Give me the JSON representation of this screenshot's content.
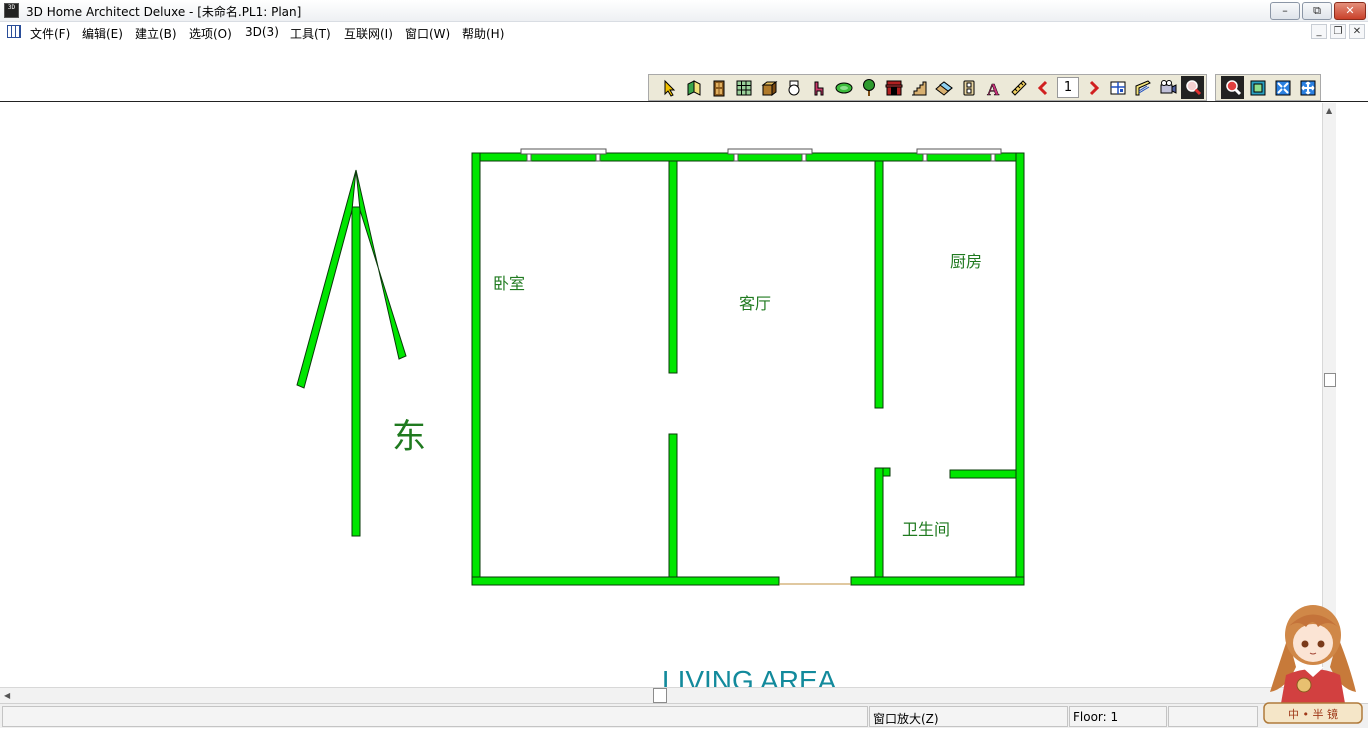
{
  "window": {
    "title": "3D Home Architect Deluxe - [未命名.PL1: Plan]",
    "app_icon_text": "3D",
    "minimize_glyph": "–",
    "restore_glyph": "⧉",
    "close_glyph": "✕"
  },
  "menu": {
    "items": [
      "文件(F)",
      "编辑(E)",
      "建立(B)",
      "选项(O)",
      "3D(3)",
      "工具(T)",
      "互联网(I)",
      "窗口(W)",
      "帮助(H)"
    ],
    "mdi_minimize": "_",
    "mdi_restore": "❐",
    "mdi_close": "✕"
  },
  "toolbar": {
    "tools": [
      "select-tool-icon",
      "wall-tool-icon",
      "door-tool-icon",
      "window-tool-icon",
      "cabinet-tool-icon",
      "fixture-tool-icon",
      "furniture-tool-icon",
      "landscape-tool-icon",
      "plant-tool-icon",
      "fireplace-tool-icon",
      "stairs-tool-icon",
      "roof-tool-icon",
      "electrical-tool-icon",
      "text-tool-icon",
      "dimension-tool-icon"
    ],
    "floor_value": "1",
    "view_tools": [
      "prev-floor-icon",
      "next-floor-icon",
      "plan-view-icon",
      "elevation-view-icon",
      "camera-view-icon",
      "zoom-tool-icon"
    ],
    "zoom_tools": [
      "zoom-in-icon",
      "zoom-window-icon",
      "fill-window-icon",
      "zoom-extents-icon"
    ]
  },
  "plan": {
    "compass_label": "东",
    "rooms": {
      "bedroom": "卧室",
      "living": "客厅",
      "kitchen": "厨房",
      "bathroom": "卫生间"
    },
    "area_label": "LIVING AREA",
    "colors": {
      "wall": "#00e600",
      "wall_outline": "#0a3a0a",
      "room_label": "#1f7a1f",
      "area_label": "#138a9c"
    }
  },
  "status": {
    "message": "",
    "command": "窗口放大(Z)",
    "floor": "Floor: 1"
  },
  "mascot": {
    "caption": "中 • 半 镜"
  }
}
